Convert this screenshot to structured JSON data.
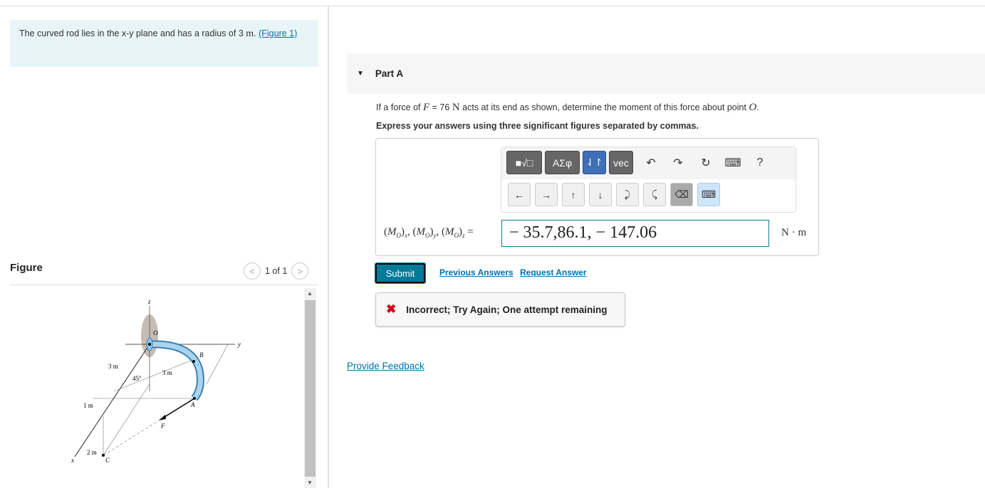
{
  "intro": {
    "text": "The curved rod lies in the x-y plane and has a radius of 3 ",
    "unit": "m",
    "period": ". ",
    "link": "(Figure 1)"
  },
  "figure": {
    "heading": "Figure",
    "pager": "1 of 1",
    "labels": {
      "z": "z",
      "y": "y",
      "x": "x",
      "O": "O",
      "B": "B",
      "A": "A",
      "F": "F",
      "C": "C",
      "d3m_a": "3 m",
      "d3m_b": "3 m",
      "angle": "45°",
      "d1m": "1 m",
      "d2m": "2 m"
    }
  },
  "part": {
    "title": "Part A"
  },
  "question": {
    "pre": "If a force of ",
    "var": "F",
    "eq": " = 76 ",
    "unit": "N",
    "post": " acts at its end as shown, determine the moment of this force about point ",
    "point": "O",
    "end": "."
  },
  "instruction": "Express your answers using three significant figures separated by commas.",
  "toolbar": {
    "templates": "■√□",
    "greek": "ΑΣφ",
    "arrows": "⇃↾",
    "vec": "vec",
    "undo": "↶",
    "redo": "↷",
    "reset": "↻",
    "keyboard": "⌨",
    "help": "?",
    "row2": [
      "←",
      "→",
      "↑",
      "↓",
      "⤸",
      "⤹",
      "⌫",
      "⌨"
    ]
  },
  "answer": {
    "label": "(M_O)x, (M_O)y, (M_O)z =",
    "value": "− 35.7,86.1, − 147.06",
    "unit": "N · m"
  },
  "actions": {
    "submit": "Submit",
    "previous": "Previous Answers",
    "request": "Request Answer"
  },
  "feedback": {
    "icon": "✖",
    "text": "Incorrect; Try Again; One attempt remaining"
  },
  "provide_feedback": "Provide Feedback"
}
